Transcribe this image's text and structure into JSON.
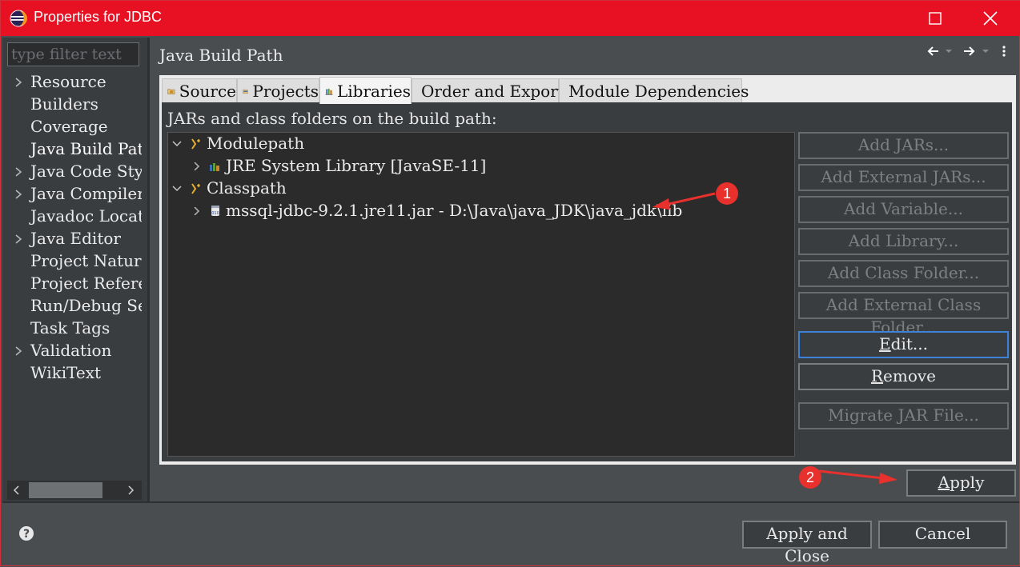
{
  "window": {
    "title": "Properties for JDBC",
    "title_bar_color": "#e81123"
  },
  "sidebar": {
    "filter_placeholder": "type filter text",
    "items": [
      {
        "label": "Resource",
        "expandable": true
      },
      {
        "label": "Builders",
        "expandable": false
      },
      {
        "label": "Coverage",
        "expandable": false
      },
      {
        "label": "Java Build Path",
        "expandable": false,
        "selected": true
      },
      {
        "label": "Java Code Style",
        "expandable": true
      },
      {
        "label": "Java Compiler",
        "expandable": true
      },
      {
        "label": "Javadoc Location",
        "expandable": false
      },
      {
        "label": "Java Editor",
        "expandable": true
      },
      {
        "label": "Project Natures",
        "expandable": false
      },
      {
        "label": "Project References",
        "expandable": false
      },
      {
        "label": "Run/Debug Settings",
        "expandable": false
      },
      {
        "label": "Task Tags",
        "expandable": false
      },
      {
        "label": "Validation",
        "expandable": true
      },
      {
        "label": "WikiText",
        "expandable": false
      }
    ]
  },
  "page": {
    "title": "Java Build Path",
    "tabs": [
      {
        "label": "Source",
        "icon": "source-folder-icon"
      },
      {
        "label": "Projects",
        "icon": "projects-icon"
      },
      {
        "label": "Libraries",
        "icon": "libraries-icon",
        "active": true
      },
      {
        "label": "Order and Export",
        "icon": "order-export-icon"
      },
      {
        "label": "Module Dependencies",
        "icon": "module-icon"
      }
    ],
    "build_path_label": "JARs and class folders on the build path:",
    "tree": {
      "modulepath": "Modulepath",
      "jre": "JRE System Library [JavaSE-11]",
      "classpath": "Classpath",
      "jar": "mssql-jdbc-9.2.1.jre11.jar - D:\\Java\\java_JDK\\java_jdk\\lib"
    },
    "buttons": {
      "add_jars": "Add JARs...",
      "add_external_jars": "Add External JARs...",
      "add_variable": "Add Variable...",
      "add_library": "Add Library...",
      "add_class_folder": "Add Class Folder...",
      "add_external_class_folder": "Add External Class Folder...",
      "edit_mnemonic": "E",
      "edit_rest": "dit...",
      "remove_mnemonic": "R",
      "remove_rest": "emove",
      "migrate_jar": "Migrate JAR File...",
      "apply_mnemonic": "A",
      "apply_rest": "pply"
    }
  },
  "footer": {
    "apply_and_close": "Apply and Close",
    "cancel": "Cancel"
  },
  "annotations": {
    "badge1": "1",
    "badge2": "2",
    "color": "#e8302c"
  }
}
